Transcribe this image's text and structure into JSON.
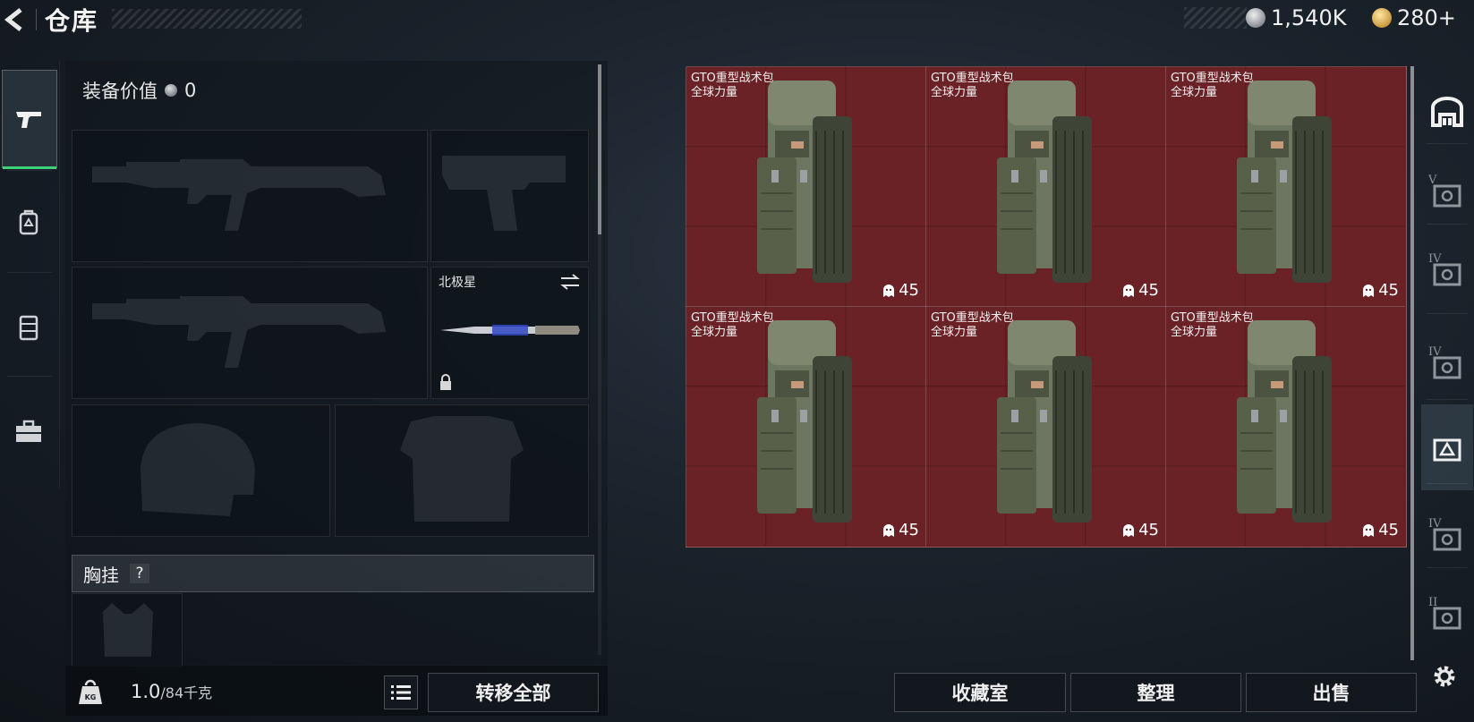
{
  "header": {
    "title": "仓库",
    "currency": [
      {
        "icon": "silver-coin-icon",
        "value": "1,540K"
      },
      {
        "icon": "gold-coin-icon",
        "value": "280+"
      }
    ]
  },
  "nav": {
    "items": [
      {
        "name": "weapons",
        "icon": "pistol-icon",
        "active": true
      },
      {
        "name": "backpack",
        "icon": "backpack-icon",
        "active": false
      },
      {
        "name": "armor",
        "icon": "vest-icon",
        "active": false
      },
      {
        "name": "medkit",
        "icon": "toolbox-icon",
        "active": false
      }
    ]
  },
  "loadout": {
    "equip_value_label": "装备价值",
    "equip_value": "0",
    "melee_label": "北极星",
    "section_chest": "胸挂",
    "help": "?",
    "weight_current": "1.0",
    "weight_capacity": "/84千克",
    "weight_icon_text": "KG",
    "transfer_all": "转移全部"
  },
  "storage": {
    "items": [
      {
        "name": "GTO重型战术包",
        "sub": "全球力量",
        "count": "45"
      },
      {
        "name": "GTO重型战术包",
        "sub": "全球力量",
        "count": "45"
      },
      {
        "name": "GTO重型战术包",
        "sub": "全球力量",
        "count": "45"
      },
      {
        "name": "GTO重型战术包",
        "sub": "全球力量",
        "count": "45"
      },
      {
        "name": "GTO重型战术包",
        "sub": "全球力量",
        "count": "45"
      },
      {
        "name": "GTO重型战术包",
        "sub": "全球力量",
        "count": "45"
      }
    ],
    "grid_color": "#6b2226"
  },
  "bottom": {
    "collection": "收藏室",
    "organize": "整理",
    "sell": "出售"
  },
  "right_tabs": [
    {
      "icon": "storage-arch-icon",
      "level": ""
    },
    {
      "icon": "container-v-icon",
      "level": "V"
    },
    {
      "icon": "container-iv-a-icon",
      "level": "IV"
    },
    {
      "icon": "container-iv-b-icon",
      "level": "IV"
    },
    {
      "icon": "container-active-icon",
      "level": ""
    },
    {
      "icon": "container-iv-c-icon",
      "level": "IV"
    },
    {
      "icon": "container-ii-icon",
      "level": "II"
    }
  ]
}
